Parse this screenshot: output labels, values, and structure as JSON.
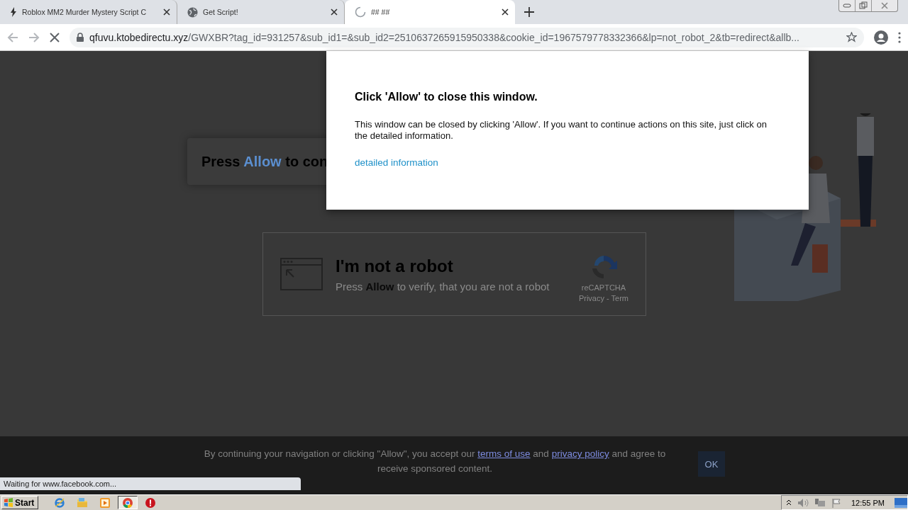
{
  "tabs": [
    {
      "label": "Roblox MM2 Murder Mystery Script C",
      "kind": "bolt",
      "selected": false
    },
    {
      "label": "Get Script!",
      "kind": "globe",
      "selected": false
    },
    {
      "label": "## ##",
      "kind": "spinner",
      "selected": true
    }
  ],
  "address_bar": {
    "host": "qfuvu.ktobedirectu.xyz",
    "path": "/GWXBR?tag_id=931257&sub_id1=&sub_id2=2510637265915950338&cookie_id=1967579778332366&lp=not_robot_2&tb=redirect&allb..."
  },
  "page": {
    "headline": {
      "before": "Press",
      "highlight": "Allow",
      "after": "to con"
    },
    "captcha": {
      "title": "I'm not a robot",
      "subtitle": "Press **Allow** to verify, that you are not a robot",
      "brand": "reCAPTCHA",
      "links": "Privacy - Term"
    }
  },
  "dialog": {
    "title": "Click 'Allow' to close this window.",
    "body": "This window can be closed by clicking 'Allow'. If you want to continue actions on this site, just click on the detailed information.",
    "link": "detailed information"
  },
  "cookie_bar": {
    "before": "By continuing your navigation or clicking \"Allow\", you accept our",
    "link_1": "terms of use",
    "middle": "and",
    "link_2": "privacy policy",
    "after": "and agree to receive sponsored content.",
    "button": "OK"
  },
  "status_text": "Waiting for www.facebook.com...",
  "taskbar": {
    "start": "Start",
    "apps": [
      {
        "kind": "ie",
        "selected": false
      },
      {
        "kind": "folder",
        "selected": false
      },
      {
        "kind": "media",
        "selected": false
      },
      {
        "kind": "chrome",
        "selected": true
      },
      {
        "kind": "stop",
        "selected": false
      }
    ],
    "clock": "12:55 PM"
  }
}
